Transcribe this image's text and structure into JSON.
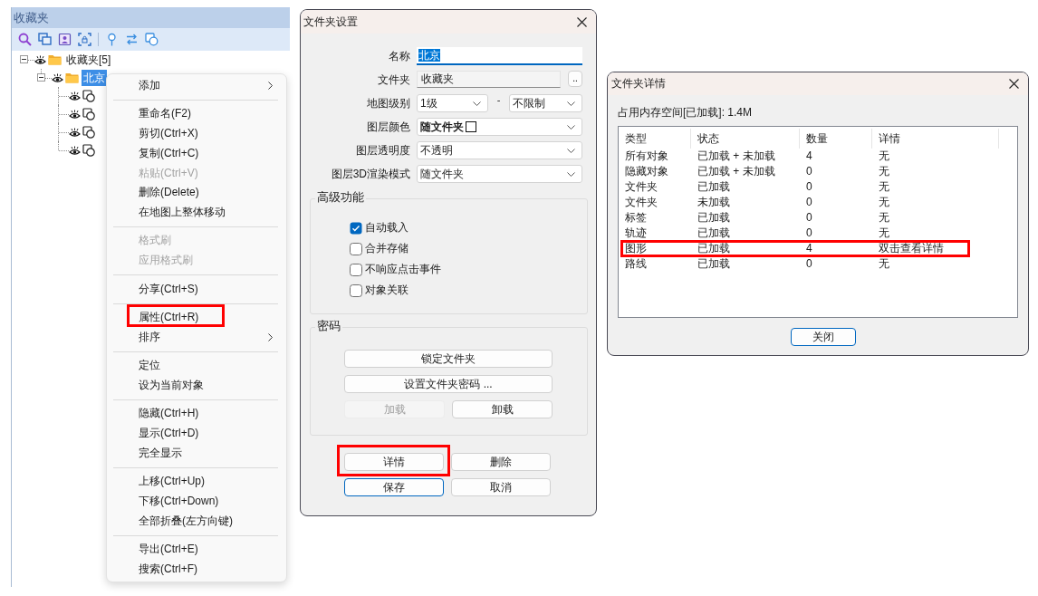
{
  "favorites_panel": {
    "title": "收藏夹",
    "tree": [
      {
        "kind": "folder",
        "label": "收藏夹[5]",
        "expanded": true,
        "visible": true,
        "selected": false,
        "children": [
          {
            "kind": "folder",
            "label": "北京",
            "expanded": true,
            "visible": true,
            "selected": true,
            "children": [
              {
                "kind": "shape",
                "visible": true
              },
              {
                "kind": "shape",
                "visible": true
              },
              {
                "kind": "shape",
                "visible": true
              },
              {
                "kind": "shape",
                "visible": true
              }
            ]
          }
        ]
      }
    ]
  },
  "context_menu": {
    "groups": [
      [
        {
          "label": "添加",
          "disabled": false,
          "submenu": true,
          "highlighted": false
        }
      ],
      [
        {
          "label": "重命名(F2)",
          "disabled": false,
          "submenu": false,
          "highlighted": false
        },
        {
          "label": "剪切(Ctrl+X)",
          "disabled": false,
          "submenu": false,
          "highlighted": false
        },
        {
          "label": "复制(Ctrl+C)",
          "disabled": false,
          "submenu": false,
          "highlighted": false
        },
        {
          "label": "粘贴(Ctrl+V)",
          "disabled": true,
          "submenu": false,
          "highlighted": false
        },
        {
          "label": "删除(Delete)",
          "disabled": false,
          "submenu": false,
          "highlighted": false
        },
        {
          "label": "在地图上整体移动",
          "disabled": false,
          "submenu": false,
          "highlighted": false
        }
      ],
      [
        {
          "label": "格式刷",
          "disabled": true,
          "submenu": false,
          "highlighted": false
        },
        {
          "label": "应用格式刷",
          "disabled": true,
          "submenu": false,
          "highlighted": false
        }
      ],
      [
        {
          "label": "分享(Ctrl+S)",
          "disabled": false,
          "submenu": false,
          "highlighted": false
        }
      ],
      [
        {
          "label": "属性(Ctrl+R)",
          "disabled": false,
          "submenu": false,
          "highlighted": true
        },
        {
          "label": "排序",
          "disabled": false,
          "submenu": true,
          "highlighted": false
        }
      ],
      [
        {
          "label": "定位",
          "disabled": false,
          "submenu": false,
          "highlighted": false
        },
        {
          "label": "设为当前对象",
          "disabled": false,
          "submenu": false,
          "highlighted": false
        }
      ],
      [
        {
          "label": "隐藏(Ctrl+H)",
          "disabled": false,
          "submenu": false,
          "highlighted": false
        },
        {
          "label": "显示(Ctrl+D)",
          "disabled": false,
          "submenu": false,
          "highlighted": false
        },
        {
          "label": "完全显示",
          "disabled": false,
          "submenu": false,
          "highlighted": false
        }
      ],
      [
        {
          "label": "上移(Ctrl+Up)",
          "disabled": false,
          "submenu": false,
          "highlighted": false
        },
        {
          "label": "下移(Ctrl+Down)",
          "disabled": false,
          "submenu": false,
          "highlighted": false
        },
        {
          "label": "全部折叠(左方向键)",
          "disabled": false,
          "submenu": false,
          "highlighted": false
        }
      ],
      [
        {
          "label": "导出(Ctrl+E)",
          "disabled": false,
          "submenu": false,
          "highlighted": false
        },
        {
          "label": "搜索(Ctrl+F)",
          "disabled": false,
          "submenu": false,
          "highlighted": false
        }
      ]
    ]
  },
  "folder_settings": {
    "title": "文件夹设置",
    "fields": [
      {
        "kind": "text",
        "label": "名称",
        "value": "北京",
        "focused": true
      },
      {
        "kind": "readonly",
        "label": "文件夹",
        "value": "收藏夹",
        "button": ".."
      },
      {
        "kind": "range",
        "label": "地图级别",
        "from": "1级",
        "separator": "-",
        "to": "不限制"
      },
      {
        "kind": "color",
        "label": "图层颜色",
        "value": "随文件夹"
      },
      {
        "kind": "select",
        "label": "图层透明度",
        "value": "不透明"
      },
      {
        "kind": "select",
        "label": "图层3D渲染模式",
        "value": "随文件夹"
      }
    ],
    "advanced": {
      "title": "高级功能",
      "options": [
        {
          "label": "自动载入",
          "checked": true
        },
        {
          "label": "合并存储",
          "checked": false
        },
        {
          "label": "不响应点击事件",
          "checked": false
        },
        {
          "label": "对象关联",
          "checked": false
        }
      ]
    },
    "password": {
      "title": "密码",
      "rows": [
        [
          {
            "label": "锁定文件夹",
            "disabled": false
          }
        ],
        [
          {
            "label": "设置文件夹密码 ...",
            "disabled": false
          }
        ],
        [
          {
            "label": "加载",
            "disabled": true
          },
          {
            "label": "卸载",
            "disabled": false
          }
        ]
      ]
    },
    "button_rows": [
      [
        {
          "label": "详情",
          "default": false,
          "highlighted": true
        },
        {
          "label": "删除",
          "default": false,
          "highlighted": false
        }
      ],
      [
        {
          "label": "保存",
          "default": true,
          "highlighted": false
        },
        {
          "label": "取消",
          "default": false,
          "highlighted": false
        }
      ]
    ]
  },
  "folder_details": {
    "title": "文件夹详情",
    "memory": "占用内存空间[已加载]: 1.4M",
    "table": {
      "columns": [
        "类型",
        "状态",
        "数量",
        "详情"
      ],
      "rows": [
        {
          "cells": [
            "所有对象",
            "已加载 + 未加载",
            "4",
            "无"
          ],
          "highlighted": false
        },
        {
          "cells": [
            "隐藏对象",
            "已加载 + 未加载",
            "0",
            "无"
          ],
          "highlighted": false
        },
        {
          "cells": [
            "文件夹",
            "已加载",
            "0",
            "无"
          ],
          "highlighted": false
        },
        {
          "cells": [
            "文件夹",
            "未加载",
            "0",
            "无"
          ],
          "highlighted": false
        },
        {
          "cells": [
            "标签",
            "已加载",
            "0",
            "无"
          ],
          "highlighted": false
        },
        {
          "cells": [
            "轨迹",
            "已加载",
            "0",
            "无"
          ],
          "highlighted": false
        },
        {
          "cells": [
            "图形",
            "已加载",
            "4",
            "双击查看详情"
          ],
          "highlighted": true
        },
        {
          "cells": [
            "路线",
            "已加载",
            "0",
            "无"
          ],
          "highlighted": false
        }
      ]
    },
    "buttons": [
      {
        "label": "关闭",
        "default": true
      }
    ]
  }
}
